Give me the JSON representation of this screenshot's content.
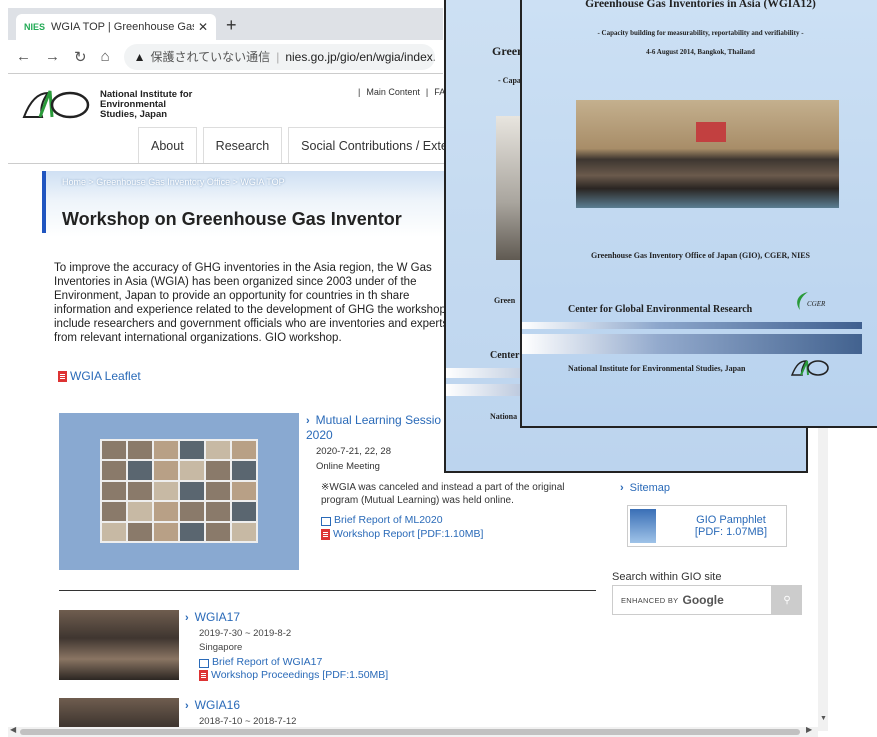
{
  "browser": {
    "tab_title": "WGIA TOP | Greenhouse Gas Inv",
    "tab_favicon": "NIES",
    "new_tab": "+",
    "security_icon": "▲",
    "security_text": "保護されていない通信",
    "separator": "|",
    "url": "nies.go.jp/gio/en/wgia/index.html"
  },
  "header": {
    "logo_text": "National Institute for Environmental Studies, Japan",
    "utility_links": [
      "Main Content",
      "FA"
    ]
  },
  "nav": {
    "items": [
      "About",
      "Research",
      "Social Contributions / Externa"
    ]
  },
  "breadcrumb": "Home > Greenhouse Gas Inventory Office > WGIA TOP",
  "page_title": "Workshop on Greenhouse Gas Inventor",
  "intro": "To improve the accuracy of GHG inventories in the Asia region, the W Gas Inventories in Asia (WGIA) has been organized since 2003 under of the Environment, Japan to provide an opportunity for countries in th share information and experience related to the development of GHG the workshops include researchers and government officials who are inventories and experts from relevant international organizations. GIO workshop.",
  "leaflet_label": "WGIA Leaflet",
  "feature": {
    "title": "Mutual Learning Sessio 2020",
    "date": "2020-7-21, 22, 28",
    "place": "Online Meeting",
    "note": "※WGIA was canceled and instead a part of the original program (Mutual Learning) was held online.",
    "links": [
      "Brief Report of ML2020",
      "Workshop Report [PDF:1.10MB]"
    ]
  },
  "entries": [
    {
      "title": "WGIA17",
      "date": "2019-7-30 ~ 2019-8-2",
      "place": "Singapore",
      "links": [
        "Brief Report of WGIA17",
        "Workshop Proceedings [PDF:1.50MB]"
      ]
    },
    {
      "title": "WGIA16",
      "date": "2018-7-10 ~ 2018-7-12",
      "place": "",
      "links": []
    }
  ],
  "sidebar": {
    "sitemap": "Sitemap",
    "pamphlet": "GIO Pamphlet",
    "pamphlet_size": "[PDF: 1.07MB]",
    "search_label": "Search within GIO site",
    "search_enhanced": "ENHANCED BY",
    "search_google": "Google"
  },
  "cover_back": {
    "title": "Green",
    "subtitle": "- Capa",
    "gio": "Green",
    "cgr": "Center",
    "nat": "Nationa"
  },
  "cover_front": {
    "title": "Greenhouse Gas Inventories in Asia (WGIA12)",
    "subtitle": "- Capacity building for measurability, reportability and verifiability -",
    "date": "4-6 August 2014, Bangkok, Thailand",
    "gio": "Greenhouse Gas Inventory Office of Japan (GIO), CGER, NIES",
    "cgr": "Center for Global Environmental Research",
    "cgr_logo": "CGER",
    "nat": "National Institute for Environmental Studies, Japan"
  }
}
